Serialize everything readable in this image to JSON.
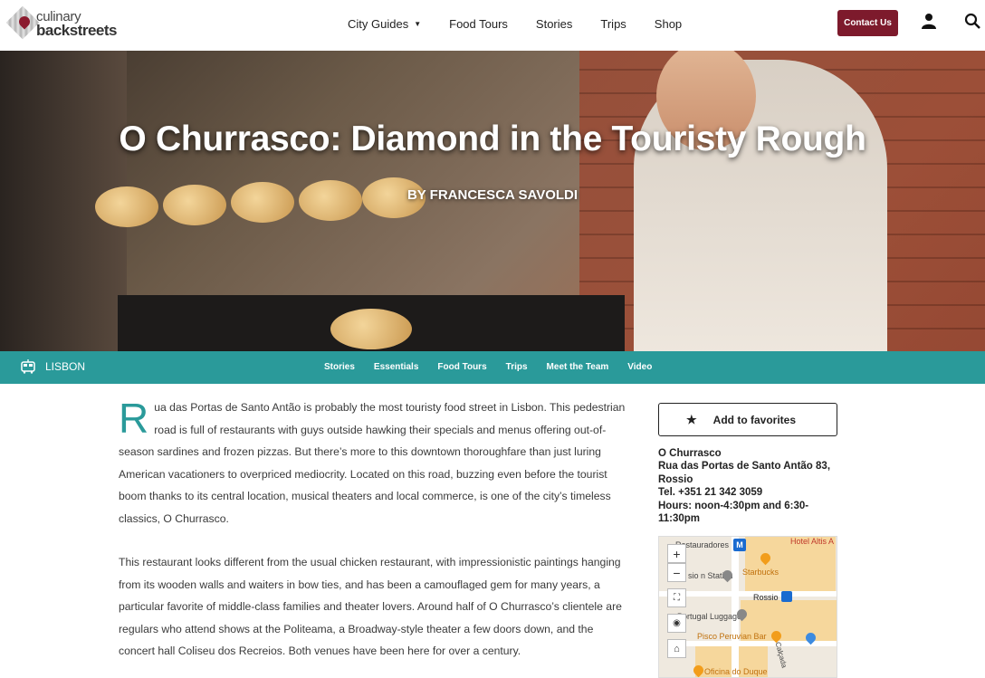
{
  "header": {
    "logo_line1": "culinary",
    "logo_line2": "backstreets",
    "nav": [
      {
        "label": "City Guides"
      },
      {
        "label": "Food Tours"
      },
      {
        "label": "Stories"
      },
      {
        "label": "Trips"
      },
      {
        "label": "Shop"
      }
    ],
    "contact_label": "Contact Us",
    "accent_color": "#7d1a2c"
  },
  "hero": {
    "title": "O Churrasco: Diamond in the Touristy Rough",
    "author": "BY FRANCESCA SAVOLDI"
  },
  "subnav": {
    "city": "LISBON",
    "links": [
      "Stories",
      "Essentials",
      "Food Tours",
      "Trips",
      "Meet the Team",
      "Video"
    ],
    "color": "#2a9a9a"
  },
  "article": {
    "dropcap": "R",
    "para1": "ua das Portas de Santo Antão is probably the most touristy food street in Lisbon. This pedestrian road is full of restaurants with guys outside hawking their specials and menus offering out-of-season sardines and frozen pizzas. But there’s more to this downtown thoroughfare than just luring American vacationers to overpriced mediocrity. Located on this road, buzzing even before the tourist boom thanks to its central location, musical theaters and local commerce, is one of the city’s timeless classics, O Churrasco.",
    "para2": "This restaurant looks different from the usual chicken restaurant, with impressionistic paintings hanging from its wooden walls and waiters in bow ties, and has been a camouflaged gem for many years, a particular favorite of middle-class families and theater lovers. Around half of O Churrasco’s clientele are regulars who attend shows at the Politeama, a Broadway-style theater a few doors down, and the concert hall Coliseu dos Recreios. Both venues have been here for over a century."
  },
  "sidebar": {
    "favorites_label": "Add to favorites",
    "venue_name": "O Churrasco",
    "venue_address": "Rua das Portas de Santo Antão 83, Rossio",
    "venue_phone": "Tel. +351 21 342 3059",
    "venue_hours": "Hours: noon-4:30pm and 6:30-11:30pm"
  },
  "map": {
    "labels": {
      "restauradores": "Restauradores",
      "hotel": "Hotel Altis A",
      "station": "sio     n Station",
      "starbucks": "Starbucks",
      "rossio": "Rossio",
      "luggage": "Portugal Luggage",
      "pisco": "Pisco Peruvian Bar",
      "oficina": "Oficina do Duque",
      "street": "Calçada"
    },
    "zoom_in": "+",
    "zoom_out": "−"
  }
}
